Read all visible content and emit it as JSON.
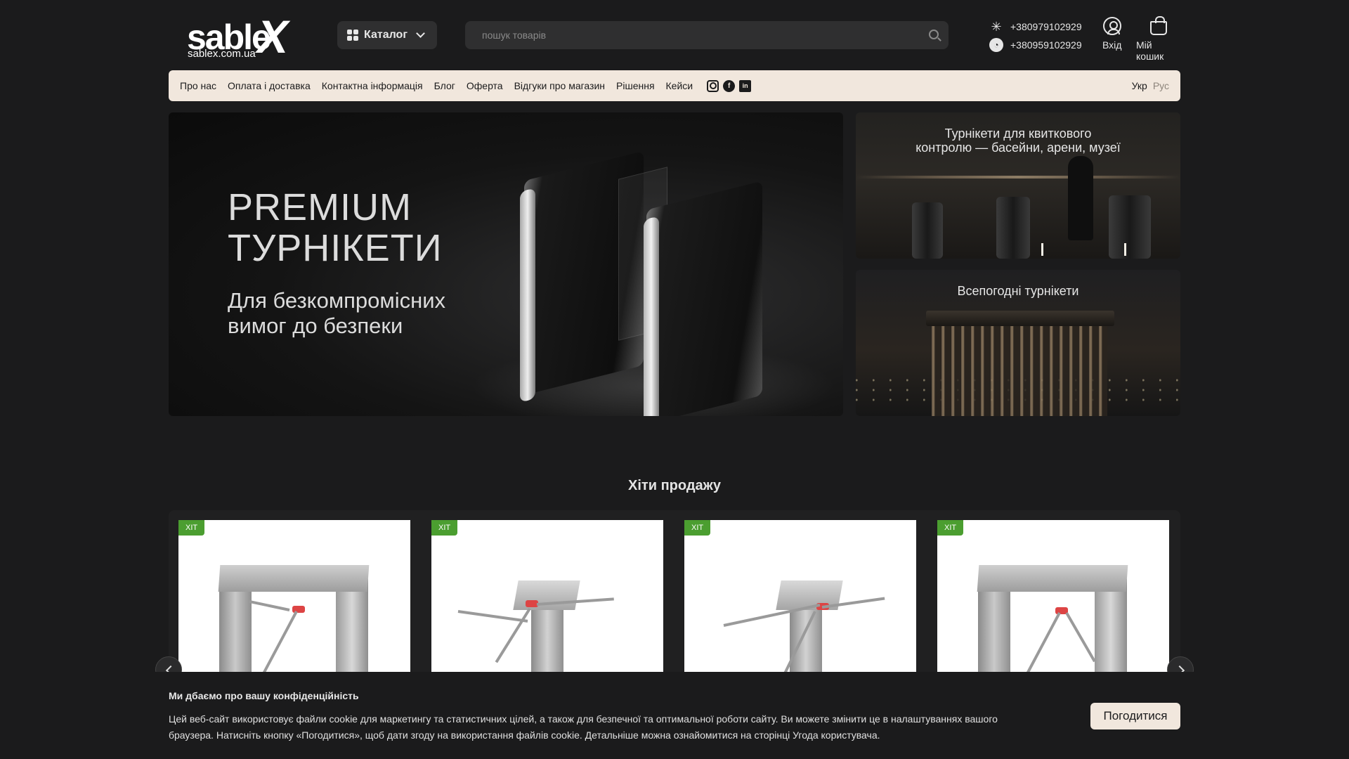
{
  "header": {
    "logo_text": "sable",
    "logo_x": "X",
    "logo_domain": "sablex.com.ua",
    "catalog_label": "Каталог",
    "search_placeholder": "пошук товарів",
    "phones": [
      {
        "number": "+380979102929",
        "icon": "kyivstar-icon"
      },
      {
        "number": "+380959102929",
        "icon": "vodafone-icon"
      }
    ],
    "login_label": "Вхід",
    "cart_label": "Мій кошик"
  },
  "nav": {
    "items": [
      "Про нас",
      "Оплата і доставка",
      "Контактна інформація",
      "Блог",
      "Оферта",
      "Відгуки про магазин",
      "Рішення",
      "Кейси"
    ],
    "social": [
      "instagram-icon",
      "facebook-icon",
      "linkedin-icon"
    ],
    "lang_active": "Укр",
    "lang_other": "Рус"
  },
  "hero": {
    "title_line1": "PREMIUM",
    "title_line2": "ТУРНІКЕТИ",
    "subtitle_line1": "Для безкомпромісних",
    "subtitle_line2": "вимог до безпеки"
  },
  "side_banners": [
    {
      "title_line1": "Турнікети для квиткового",
      "title_line2": "контролю — басейни, арени, музеї"
    },
    {
      "title_line1": "Всепогодні турнікети"
    }
  ],
  "hits": {
    "title": "Хіти продажу",
    "badge": "ХІТ",
    "cards": [
      {
        "badge": "ХІТ"
      },
      {
        "badge": "ХІТ"
      },
      {
        "badge": "ХІТ"
      },
      {
        "badge": "ХІТ"
      }
    ]
  },
  "cookie": {
    "title": "Ми дбаємо про вашу конфіденційність",
    "text": "Цей веб-сайт використовує файли cookie для маркетингу та статистичних цілей, а також для безпечної та оптимальної роботи сайту. Ви можете змінити це в налаштуваннях вашого браузера. Натисніть кнопку «Погодитися», щоб дати згоду на використання файлів cookie. Детальніше можна ознайомитися на сторінці Угода користувача.",
    "agree_label": "Погодитися"
  },
  "colors": {
    "background": "#1b1b1c",
    "nav_bg": "#f1e7dd",
    "badge": "#4b9e30"
  }
}
